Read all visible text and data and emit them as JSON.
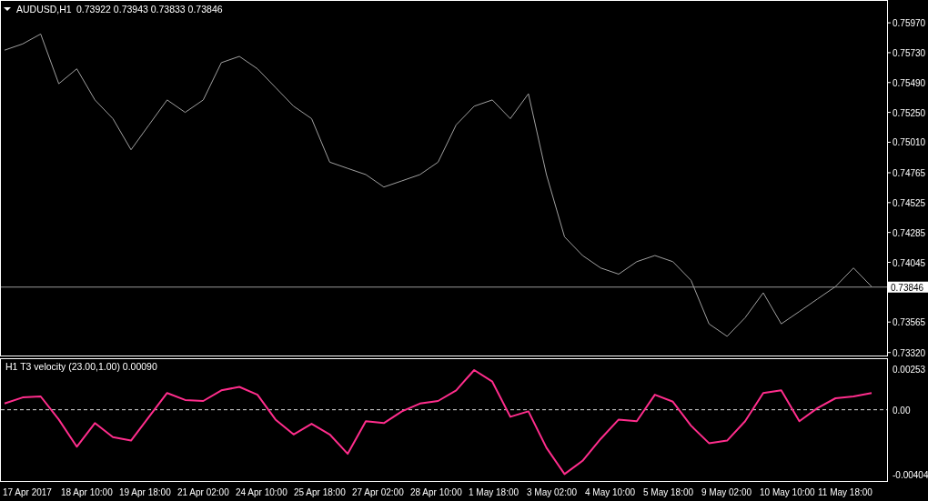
{
  "price_panel": {
    "symbol": "AUDUSD,H1",
    "quotes": "0.73922 0.73943 0.73833 0.73846",
    "chart_data": {
      "type": "line",
      "ylim": [
        0.73296,
        0.76146
      ],
      "yticks": [
        {
          "value": 0.7597,
          "label": "0.75970"
        },
        {
          "value": 0.7573,
          "label": "0.75730"
        },
        {
          "value": 0.7549,
          "label": "0.75490"
        },
        {
          "value": 0.7525,
          "label": "0.75250"
        },
        {
          "value": 0.7501,
          "label": "0.75010"
        },
        {
          "value": 0.74765,
          "label": "0.74765"
        },
        {
          "value": 0.74525,
          "label": "0.74525"
        },
        {
          "value": 0.74285,
          "label": "0.74285"
        },
        {
          "value": 0.74045,
          "label": "0.74045"
        },
        {
          "value": 0.73565,
          "label": "0.73565"
        },
        {
          "value": 0.7332,
          "label": "0.73320"
        }
      ],
      "series": [
        {
          "color": "#a0a0a0",
          "values": [
            0.7575,
            0.758,
            0.7588,
            0.7548,
            0.756,
            0.7535,
            0.752,
            0.7495,
            0.7515,
            0.7535,
            0.7525,
            0.7535,
            0.7565,
            0.757,
            0.756,
            0.7545,
            0.753,
            0.752,
            0.7485,
            0.748,
            0.7475,
            0.7465,
            0.747,
            0.7475,
            0.7485,
            0.7515,
            0.753,
            0.7535,
            0.752,
            0.754,
            0.7475,
            0.7425,
            0.741,
            0.74,
            0.7395,
            0.7405,
            0.741,
            0.7405,
            0.739,
            0.7355,
            0.7345,
            0.736,
            0.738,
            0.7355,
            0.7365,
            0.7375,
            0.7385,
            0.74,
            0.7385
          ]
        }
      ],
      "ref_lines": [
        {
          "axis": "y",
          "value": 0.73846,
          "label": "0.73846"
        }
      ]
    }
  },
  "indicator_panel": {
    "label": "H1 T3 velocity (23.00,1.00) 0.00090",
    "chart_data": {
      "type": "line",
      "ylim": [
        -0.00445,
        0.00316
      ],
      "yticks": [
        {
          "value": 0.00253,
          "label": "0.00253"
        },
        {
          "value": 0,
          "label": "0.00"
        },
        {
          "value": -0.00404,
          "label": "-0.00404"
        }
      ],
      "series": [
        {
          "color": "#ff2d8c",
          "values": [
            0.00039,
            0.00077,
            0.00083,
            -0.00061,
            -0.00231,
            -0.00083,
            -0.00171,
            -0.00193,
            -0.00044,
            0.00105,
            0.00061,
            0.00055,
            0.00121,
            0.00143,
            0.00094,
            -0.00061,
            -0.00154,
            -0.00088,
            -0.00154,
            -0.00275,
            -0.00072,
            -0.00083,
            -0.0001,
            0.00039,
            0.00055,
            0.00121,
            0.00248,
            0.00176,
            -0.00044,
            -0.0001,
            -0.00237,
            -0.00402,
            -0.00319,
            -0.00182,
            -0.00061,
            -0.00072,
            0.00094,
            0.0005,
            -0.00099,
            -0.00209,
            -0.00193,
            -0.00072,
            0.00105,
            0.00121,
            -0.00072,
            0.0001,
            0.00072,
            0.00083,
            0.00105
          ]
        }
      ]
    }
  },
  "time_axis": [
    "17 Apr 2017",
    "18 Apr 10:00",
    "19 Apr 18:00",
    "21 Apr 02:00",
    "24 Apr 10:00",
    "25 Apr 18:00",
    "27 Apr 02:00",
    "28 Apr 10:00",
    "1 May 18:00",
    "3 May 02:00",
    "4 May 10:00",
    "5 May 18:00",
    "9 May 02:00",
    "10 May 10:00",
    "11 May 18:00"
  ]
}
